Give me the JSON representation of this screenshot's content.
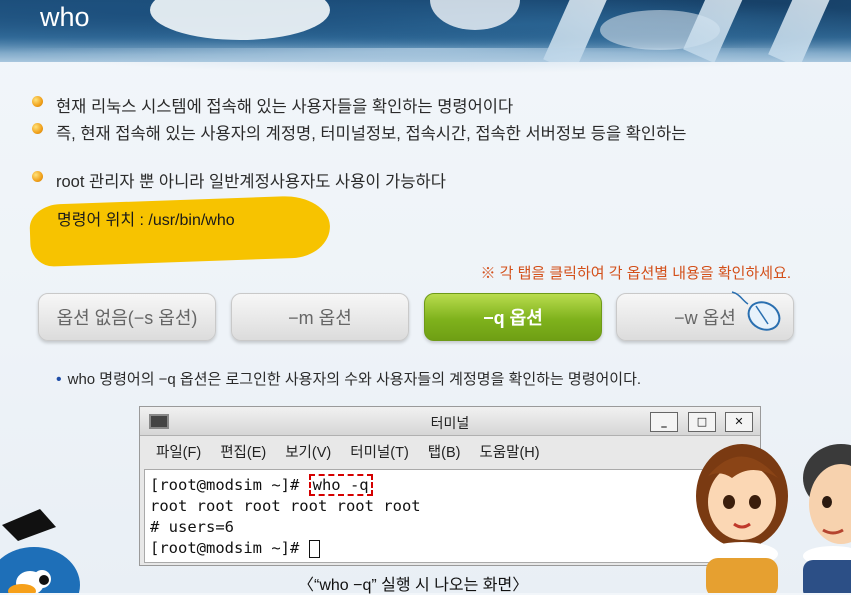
{
  "page_title": "who",
  "bullets": [
    "현재 리눅스 시스템에 접속해 있는 사용자들을 확인하는 명령어이다",
    "즉, 현재 접속해 있는 사용자의 계정명, 터미널정보, 접속시간, 접속한 서버정보 등을 확인하는",
    "root 관리자 뿐 아니라 일반계정사용자도 사용이 가능하다"
  ],
  "command_path": "명령어 위치 : /usr/bin/who",
  "hint": "※ 각 탭을 클릭하여 각 옵션별 내용을 확인하세요.",
  "tabs": [
    {
      "label": "옵션 없음(−s 옵션)",
      "active": false
    },
    {
      "label": "−m 옵션",
      "active": false
    },
    {
      "label": "−q 옵션",
      "active": true
    },
    {
      "label": "−w 옵션",
      "active": false
    }
  ],
  "description": "who 명령어의 −q 옵션은 로그인한 사용자의 수와 사용자들의 계정명을 확인하는 명령어이다.",
  "terminal": {
    "title": "터미널",
    "menu": [
      "파일(F)",
      "편집(E)",
      "보기(V)",
      "터미널(T)",
      "탭(B)",
      "도움말(H)"
    ],
    "window_buttons": [
      "_",
      "□",
      "✕"
    ],
    "prompt": "[root@modsim ~]# ",
    "command": "who -q",
    "output_line1": "root root root root root root",
    "output_line2": "# users=6",
    "prompt2": "[root@modsim ~]# "
  },
  "caption": "〈“who −q” 실행 시 나오는 화면〉",
  "colors": {
    "active_tab": "#7fb21c",
    "hint": "#d3501a",
    "highlight_box": "#d40000",
    "banner": "#1d4e79"
  }
}
